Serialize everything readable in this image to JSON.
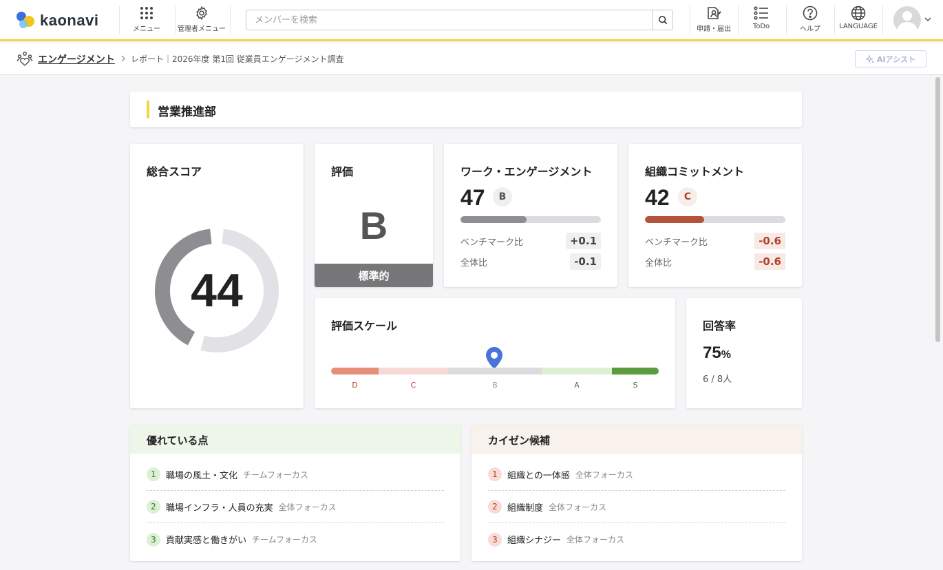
{
  "header": {
    "logo_text": "kaonavi",
    "menu_label": "メニュー",
    "admin_menu_label": "管理者メニュー",
    "search_placeholder": "メンバーを検索",
    "apply_label": "申請・届出",
    "todo_label": "ToDo",
    "help_label": "ヘルプ",
    "language_label": "LANGUAGE",
    "icons": [
      "grid-icon",
      "gear-icon",
      "search-icon",
      "application-icon",
      "todo-list-icon",
      "help-icon",
      "globe-icon",
      "avatar-icon",
      "chevron-down-icon"
    ]
  },
  "breadcrumb": {
    "section": "エンゲージメント",
    "page": "レポート｜2026年度 第1回 従業員エンゲージメント調査",
    "ai_button": "AIアシスト"
  },
  "department": {
    "name": "営業推進部"
  },
  "total_score": {
    "title": "総合スコア",
    "value": "44",
    "fraction": 0.44,
    "fill_color": "#8e8e92",
    "track_color": "#e2e2e6"
  },
  "rating": {
    "title": "評価",
    "grade": "B",
    "band": "標準的"
  },
  "work_engagement": {
    "title": "ワーク・エンゲージメント",
    "score": "47",
    "grade": "B",
    "fraction": 0.47,
    "bar_color": "#8e8e92",
    "benchmark_label": "ベンチマーク比",
    "benchmark_value": "+0.1",
    "overall_label": "全体比",
    "overall_value": "-0.1"
  },
  "org_commitment": {
    "title": "組織コミットメント",
    "score": "42",
    "grade": "C",
    "fraction": 0.42,
    "bar_color": "#b3533a",
    "benchmark_label": "ベンチマーク比",
    "benchmark_value": "-0.6",
    "overall_label": "全体比",
    "overall_value": "-0.6"
  },
  "rating_scale": {
    "title": "評価スケール",
    "current": "B",
    "levels": [
      {
        "label": "D",
        "color": "#e5917a",
        "label_color": "#b0412a"
      },
      {
        "label": "C",
        "color": "#f5d9d2",
        "label_color": "#b0412a"
      },
      {
        "label": "B",
        "color": "#dcdcdf",
        "label_color": "#999999"
      },
      {
        "label": "A",
        "color": "#dcf0d4",
        "label_color": "#3c7a2c"
      },
      {
        "label": "S",
        "color": "#5b9c3e",
        "label_color": "#3c7a2c"
      }
    ],
    "pin_color": "#4a72d8"
  },
  "response_rate": {
    "title": "回答率",
    "value": "75",
    "unit": "%",
    "count": "6 / 8人"
  },
  "strengths": {
    "title": "優れている点",
    "header_bg": "#eef6ea",
    "num_bg": "#dcf0d4",
    "num_color": "#3c7a2c",
    "items": [
      {
        "num": "1",
        "text": "職場の風土・文化",
        "tag": "チームフォーカス"
      },
      {
        "num": "2",
        "text": "職場インフラ・人員の充実",
        "tag": "全体フォーカス"
      },
      {
        "num": "3",
        "text": "貢献実感と働きがい",
        "tag": "チームフォーカス"
      }
    ]
  },
  "improvements": {
    "title": "カイゼン候補",
    "header_bg": "#f8f1ec",
    "num_bg": "#f8dcd5",
    "num_color": "#b0412a",
    "items": [
      {
        "num": "1",
        "text": "組織との一体感",
        "tag": "全体フォーカス"
      },
      {
        "num": "2",
        "text": "組織制度",
        "tag": "全体フォーカス"
      },
      {
        "num": "3",
        "text": "組織シナジー",
        "tag": "全体フォーカス"
      }
    ]
  }
}
